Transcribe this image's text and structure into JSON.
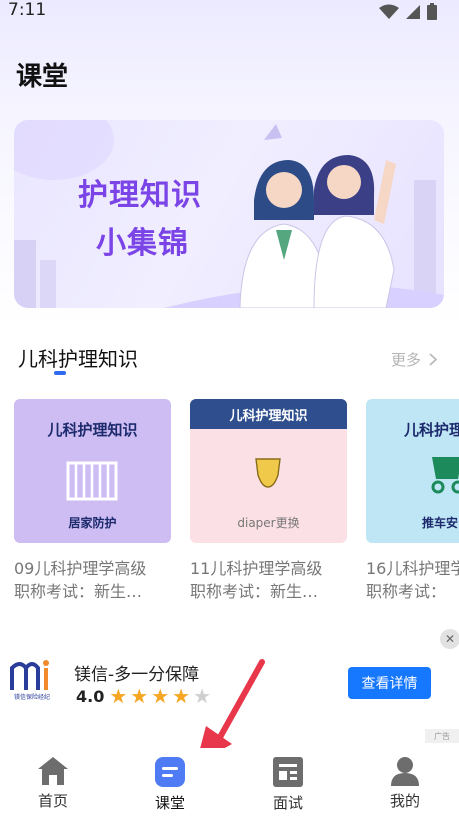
{
  "status_bar": {
    "time": "7:11",
    "icons": [
      "wifi-icon",
      "signal-icon",
      "battery-icon"
    ]
  },
  "page": {
    "title": "课堂"
  },
  "banner": {
    "line1": "护理知识",
    "line2": "小集锦"
  },
  "section": {
    "title": "儿科护理知识",
    "more_label": "更多"
  },
  "cards": [
    {
      "thumb_title": "儿科护理知识",
      "thumb_sub": "居家防护",
      "thumb_color": "#cdbdf3",
      "caption_line1": "09儿科护理学高级",
      "caption_line2": "职称考试：新生…"
    },
    {
      "thumb_title": "儿科护理知识",
      "thumb_sub": "diaper更换",
      "thumb_color": "#fbe0e6",
      "caption_line1": "11儿科护理学高级",
      "caption_line2": "职称考试：新生…"
    },
    {
      "thumb_title": "儿科护理",
      "thumb_sub": "推车安",
      "thumb_color": "#bfe6f4",
      "caption_line1": "16儿科护理学",
      "caption_line2": "职称考试："
    }
  ],
  "ad": {
    "logo_text": "镁信保险经纪",
    "title": "镁信-多一分保障",
    "rating": "4.0",
    "stars_filled": 4,
    "stars_total": 5,
    "button_label": "查看详情",
    "tag": "广告"
  },
  "nav": [
    {
      "label": "首页",
      "icon": "home-icon",
      "active": false
    },
    {
      "label": "课堂",
      "icon": "classroom-icon",
      "active": true
    },
    {
      "label": "面试",
      "icon": "interview-icon",
      "active": false
    },
    {
      "label": "我的",
      "icon": "profile-icon",
      "active": false
    }
  ],
  "colors": {
    "accent": "#2f6bf0",
    "banner_text": "#7a44e6",
    "ad_button": "#1677ff",
    "arrow": "#e8364a"
  }
}
